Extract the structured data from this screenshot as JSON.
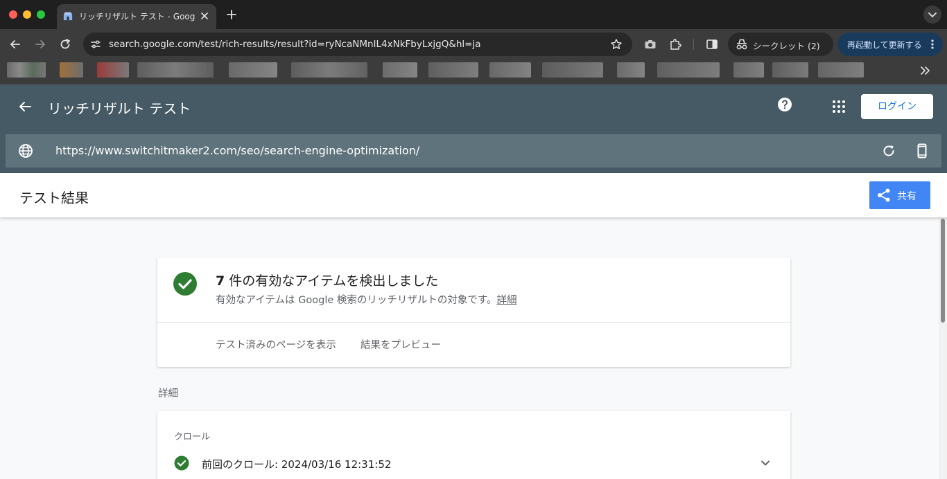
{
  "browser": {
    "tab_title": "リッチリザルト テスト - Google",
    "address": "search.google.com/test/rich-results/result?id=ryNcaNMnIL4xNkFbyLxjgQ&hl=ja",
    "incognito_label": "シークレット (2)",
    "relaunch_label": "再起動して更新する",
    "icons": [
      "back-icon",
      "forward-icon",
      "reload-icon",
      "site-settings-icon",
      "star-icon",
      "camera-icon",
      "extensions-icon",
      "side-panel-icon",
      "incognito-icon",
      "more-icon"
    ]
  },
  "app": {
    "title": "リッチリザルト テスト",
    "login_label": "ログイン",
    "tested_url": "https://www.switchitmaker2.com/seo/search-engine-optimization/"
  },
  "results": {
    "title": "テスト結果",
    "share_label": "共有"
  },
  "summary": {
    "count": "7",
    "title_rest": " 件の有効なアイテムを検出しました",
    "subtitle": "有効なアイテムは Google 検索のリッチリザルトの対象です。",
    "details_link": "詳細",
    "action_view_page": "テスト済みのページを表示",
    "action_preview": "結果をプレビュー"
  },
  "details": {
    "section_label": "詳細",
    "crawl_heading": "クロール",
    "crawl_text": "前回のクロール: 2024/03/16 12:31:52"
  },
  "colors": {
    "header_bg": "#455a64",
    "urlbar_bg": "#5f737d",
    "share_bg": "#4285f4",
    "success_green": "#2e7d32"
  }
}
